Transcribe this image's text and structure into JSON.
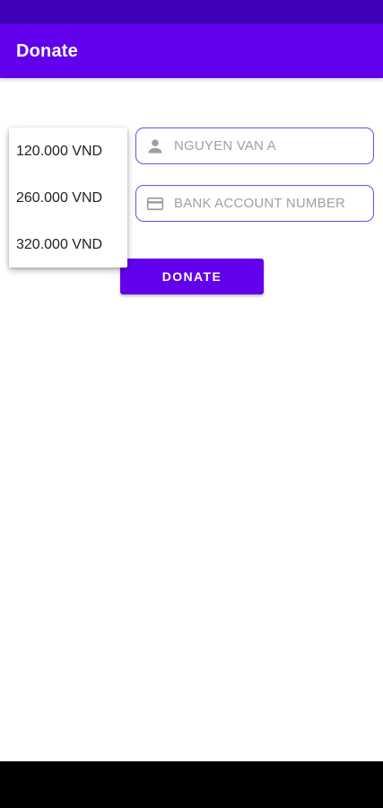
{
  "app_bar": {
    "title": "Donate"
  },
  "form": {
    "name_placeholder": "NGUYEN VAN A",
    "name_icon": "person-icon",
    "bank_placeholder": "BANK ACCOUNT NUMBER",
    "bank_icon": "credit-card-icon",
    "donate_label": "DONATE"
  },
  "amount_menu": {
    "items": [
      {
        "label": "120.000 VND"
      },
      {
        "label": "260.000 VND"
      },
      {
        "label": "320.000 VND"
      }
    ]
  },
  "colors": {
    "primary": "#6200ee",
    "status_bar": "#3f00b8",
    "field_outline": "#6b4cf0"
  }
}
